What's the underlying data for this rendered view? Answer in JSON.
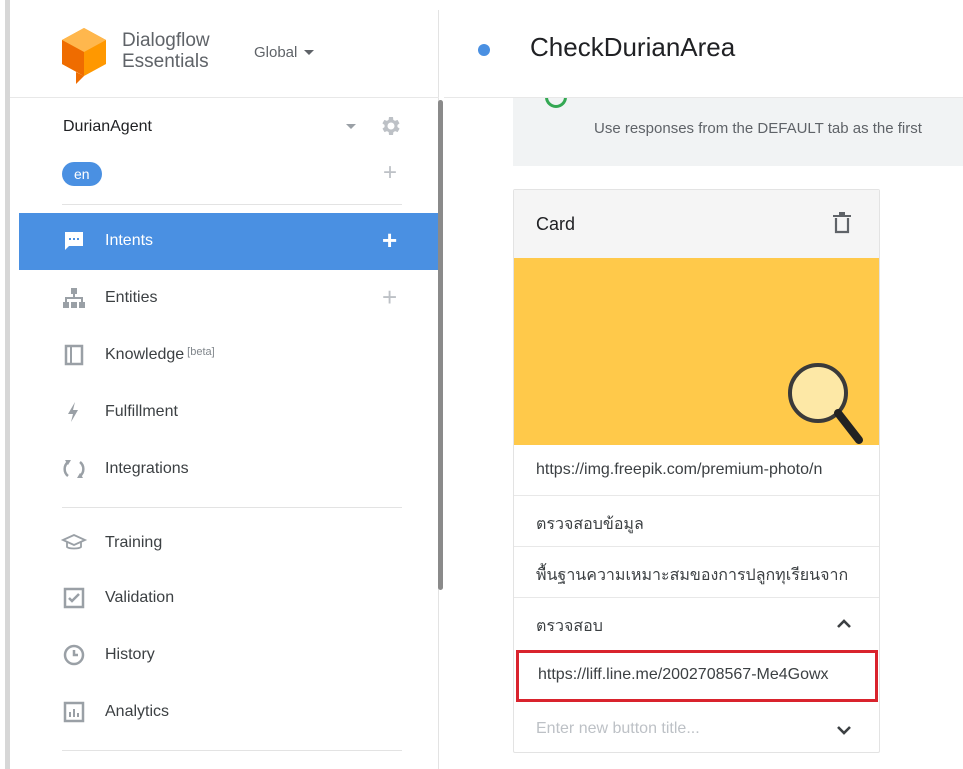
{
  "app": {
    "brand_line1": "Dialogflow",
    "brand_line2": "Essentials",
    "region": "Global",
    "accent_color": "#4a90e2"
  },
  "agent": {
    "name": "DurianAgent",
    "language": "en"
  },
  "sidebar": {
    "items": [
      {
        "label": "Intents",
        "icon": "chat-bubble-icon",
        "active": true
      },
      {
        "label": "Entities",
        "icon": "hierarchy-icon"
      },
      {
        "label": "Knowledge",
        "badge": "[beta]",
        "icon": "book-icon"
      },
      {
        "label": "Fulfillment",
        "icon": "lightning-icon"
      },
      {
        "label": "Integrations",
        "icon": "sync-arrows-icon"
      },
      {
        "label": "Training",
        "icon": "graduation-cap-icon"
      },
      {
        "label": "Validation",
        "icon": "checkbox-icon"
      },
      {
        "label": "History",
        "icon": "clock-icon"
      },
      {
        "label": "Analytics",
        "icon": "bar-chart-icon"
      }
    ]
  },
  "header": {
    "intent_name": "CheckDurianArea"
  },
  "notice": {
    "text": "Use responses from the DEFAULT tab as the first"
  },
  "card": {
    "title": "Card",
    "image_url": "https://img.freepik.com/premium-photo/n",
    "card_title": "ตรวจสอบข้อมูล",
    "card_subtitle": "พื้นฐานความเหมาะสมของการปลูกทุเรียนจาก",
    "button_title": "ตรวจสอบ",
    "button_url": "https://liff.line.me/2002708567-Me4Gowx",
    "new_button_placeholder": "Enter new button title..."
  }
}
